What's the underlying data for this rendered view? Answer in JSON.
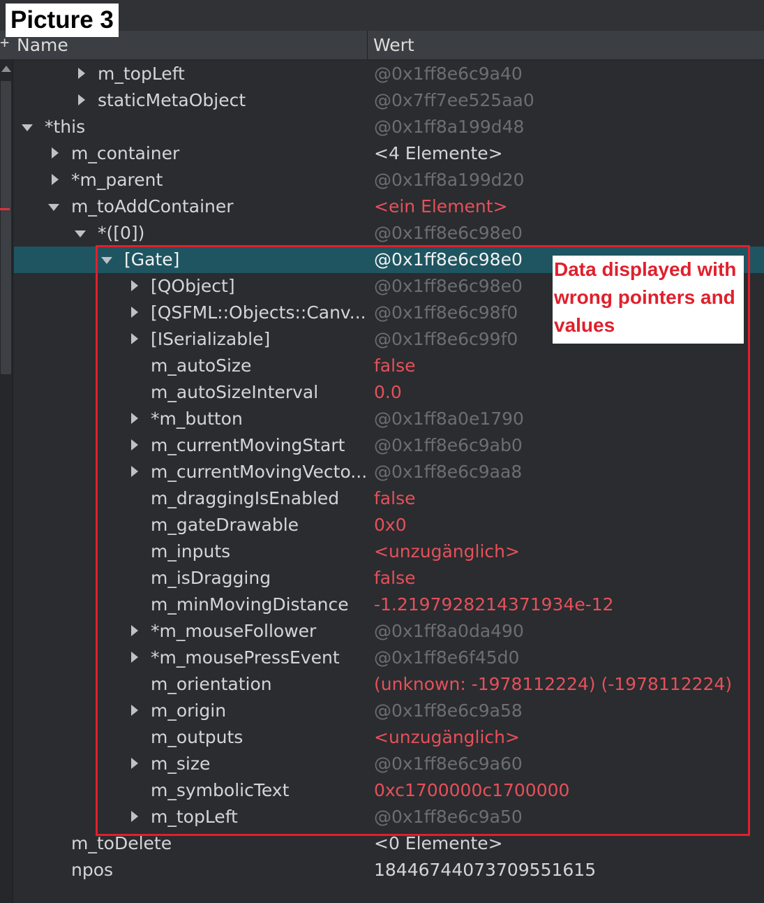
{
  "picture_label": "Picture 3",
  "header": {
    "plus_glyph": "+",
    "name_col": "Name",
    "value_col": "Wert"
  },
  "annotation": {
    "lines": [
      "Data displayed with",
      "wrong pointers and",
      "values"
    ],
    "color": "#e0202c"
  },
  "rows": [
    {
      "name": "m_topLeft",
      "value": "@0x1ff8e6c9a40"
    },
    {
      "name": "staticMetaObject",
      "value": "@0x7ff7ee525aa0"
    },
    {
      "name": "*this",
      "value": "@0x1ff8a199d48"
    },
    {
      "name": "m_container",
      "value": "<4 Elemente>"
    },
    {
      "name": "*m_parent",
      "value": "@0x1ff8a199d20"
    },
    {
      "name": "m_toAddContainer",
      "value": "<ein Element>"
    },
    {
      "name": "*([0])",
      "value": "@0x1ff8e6c98e0"
    },
    {
      "name": "[Gate]",
      "value": "@0x1ff8e6c98e0"
    },
    {
      "name": "[QObject]",
      "value": "@0x1ff8e6c98e0"
    },
    {
      "name": "[QSFML::Objects::Canv...",
      "value": "@0x1ff8e6c98f0"
    },
    {
      "name": "[ISerializable]",
      "value": "@0x1ff8e6c99f0"
    },
    {
      "name": "m_autoSize",
      "value": "false"
    },
    {
      "name": "m_autoSizeInterval",
      "value": "0.0"
    },
    {
      "name": "*m_button",
      "value": "@0x1ff8a0e1790"
    },
    {
      "name": "m_currentMovingStart",
      "value": "@0x1ff8e6c9ab0"
    },
    {
      "name": "m_currentMovingVecto...",
      "value": "@0x1ff8e6c9aa8"
    },
    {
      "name": "m_draggingIsEnabled",
      "value": "false"
    },
    {
      "name": "m_gateDrawable",
      "value": "0x0"
    },
    {
      "name": "m_inputs",
      "value": "<unzugänglich>"
    },
    {
      "name": "m_isDragging",
      "value": "false"
    },
    {
      "name": "m_minMovingDistance",
      "value": "-1.2197928214371934e-12"
    },
    {
      "name": "*m_mouseFollower",
      "value": "@0x1ff8a0da490"
    },
    {
      "name": "*m_mousePressEvent",
      "value": "@0x1ff8e6f45d0"
    },
    {
      "name": "m_orientation",
      "value": "(unknown: -1978112224) (-1978112224)"
    },
    {
      "name": "m_origin",
      "value": "@0x1ff8e6c9a58"
    },
    {
      "name": "m_outputs",
      "value": "<unzugänglich>"
    },
    {
      "name": "m_size",
      "value": "@0x1ff8e6c9a60"
    },
    {
      "name": "m_symbolicText",
      "value": "0xc1700000c1700000"
    },
    {
      "name": "m_topLeft",
      "value": "@0x1ff8e6c9a50"
    },
    {
      "name": "m_toDelete",
      "value": "<0 Elemente>"
    },
    {
      "name": "npos",
      "value": "18446744073709551615"
    }
  ]
}
